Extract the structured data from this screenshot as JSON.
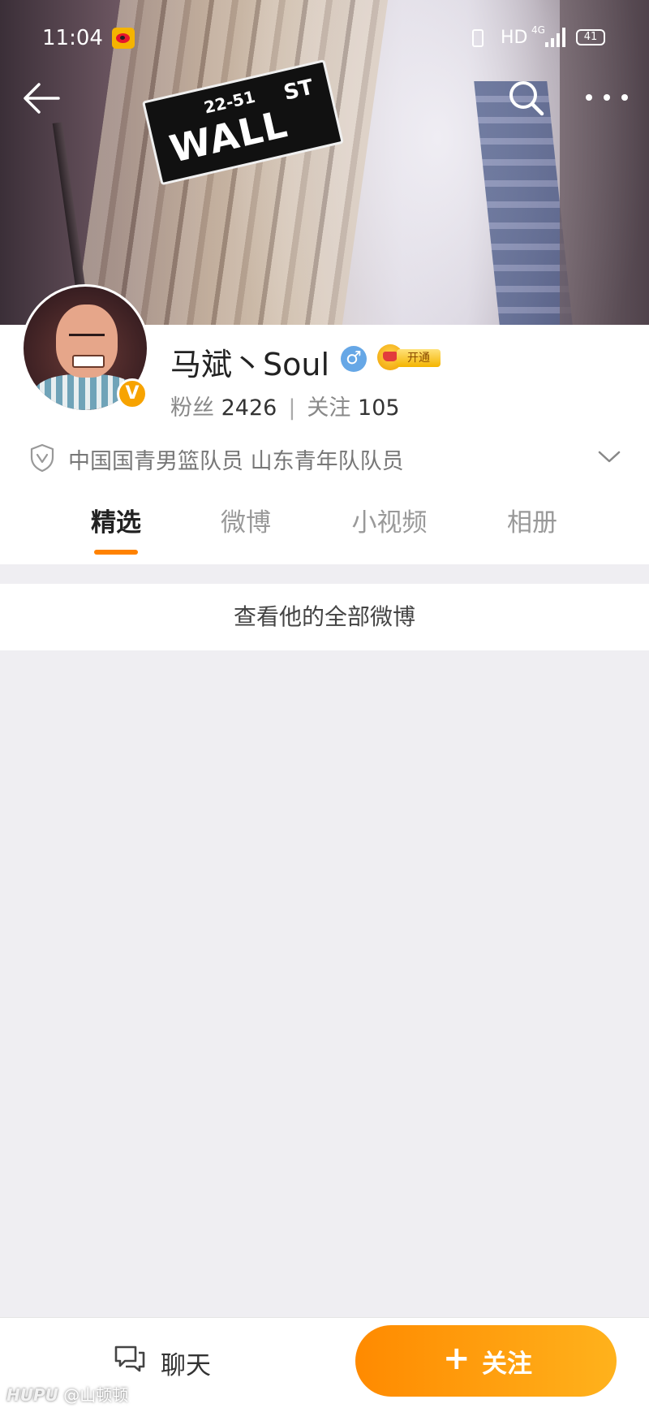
{
  "status_bar": {
    "time": "11:04",
    "hd": "HD",
    "network": "4G",
    "battery": "41"
  },
  "cover": {
    "sign_number": "22-51",
    "sign_main": "WALL",
    "sign_suffix": "ST"
  },
  "profile": {
    "name": "马斌丶Soul",
    "gender_symbol": "♂",
    "verified_symbol": "V",
    "vip_label": "开通",
    "followers_label": "粉丝",
    "followers_count": "2426",
    "following_label": "关注",
    "following_count": "105",
    "stats_separator": "|",
    "verification_text": "中国国青男篮队员 山东青年队队员"
  },
  "tabs": [
    {
      "label": "精选",
      "active": true
    },
    {
      "label": "微博",
      "active": false
    },
    {
      "label": "小视频",
      "active": false
    },
    {
      "label": "相册",
      "active": false
    }
  ],
  "view_all_label": "查看他的全部微博",
  "bottom_bar": {
    "chat_label": "聊天",
    "follow_plus": "+",
    "follow_label": "关注"
  },
  "watermark": {
    "brand": "HUPU",
    "handle": "@山顿顿"
  },
  "colors": {
    "accent": "#ff8200",
    "verified": "#f7a300",
    "gender": "#66a7e6",
    "background": "#efeef2"
  },
  "icons": {
    "app": "weibo-icon",
    "back": "back-arrow-icon",
    "search": "search-icon",
    "more": "more-dots-icon",
    "verification": "shield-icon",
    "expand": "chevron-down-icon",
    "chat": "chat-bubble-icon"
  }
}
